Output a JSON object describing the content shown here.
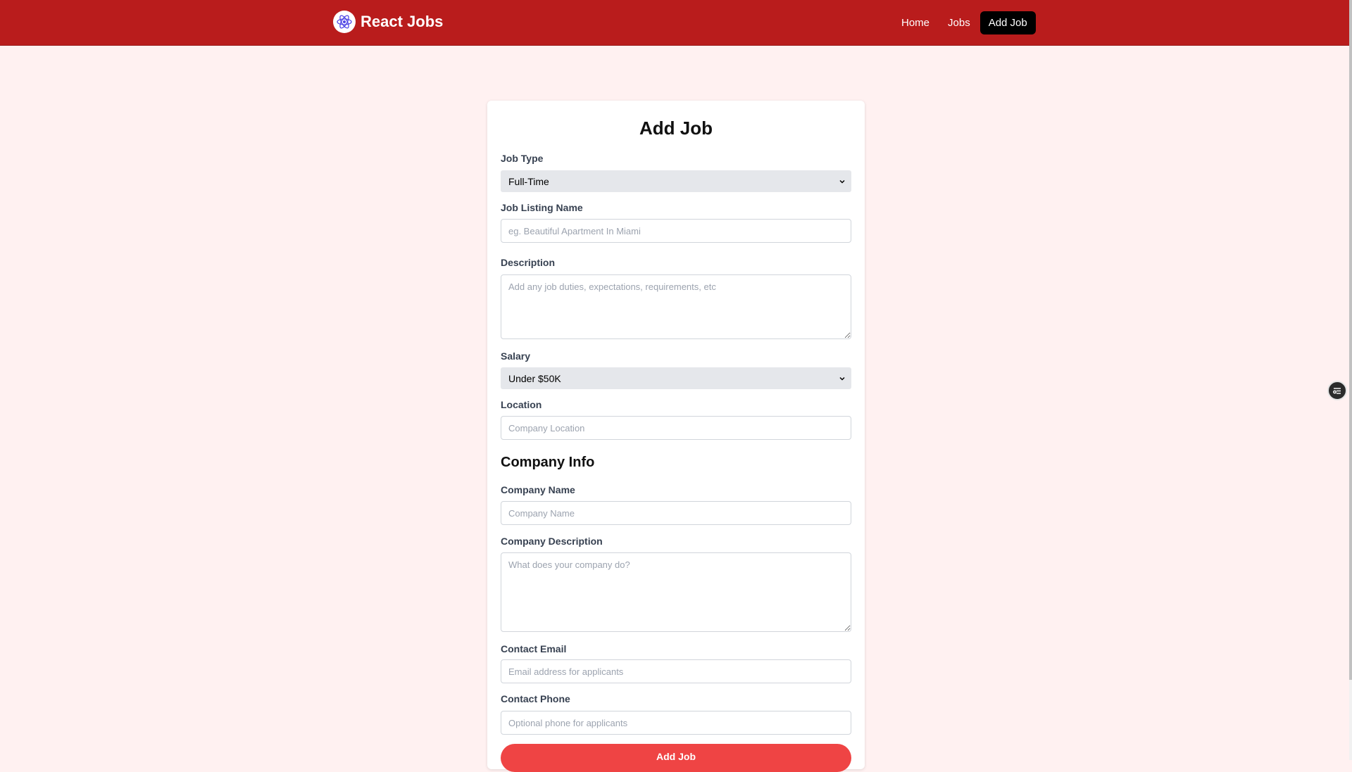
{
  "nav": {
    "brand": "React Jobs",
    "links": [
      {
        "label": "Home",
        "active": false
      },
      {
        "label": "Jobs",
        "active": false
      },
      {
        "label": "Add Job",
        "active": true
      }
    ],
    "brand_color": "#b91c1c"
  },
  "form": {
    "title": "Add Job",
    "job_type": {
      "label": "Job Type",
      "value": "Full-Time"
    },
    "job_name": {
      "label": "Job Listing Name",
      "placeholder": "eg. Beautiful Apartment In Miami"
    },
    "description": {
      "label": "Description",
      "placeholder": "Add any job duties, expectations, requirements, etc"
    },
    "salary": {
      "label": "Salary",
      "value": "Under $50K"
    },
    "location": {
      "label": "Location",
      "placeholder": "Company Location"
    },
    "company_section": "Company Info",
    "company_name": {
      "label": "Company Name",
      "placeholder": "Company Name"
    },
    "company_description": {
      "label": "Company Description",
      "placeholder": "What does your company do?"
    },
    "contact_email": {
      "label": "Contact Email",
      "placeholder": "Email address for applicants"
    },
    "contact_phone": {
      "label": "Contact Phone",
      "placeholder": "Optional phone for applicants"
    },
    "submit_label": "Add Job",
    "submit_color": "#ef4444"
  },
  "icons": {
    "brand_logo": "react-logo-icon",
    "select_arrow": "chevron-down-icon",
    "floating": "settings-toggle-icon"
  }
}
